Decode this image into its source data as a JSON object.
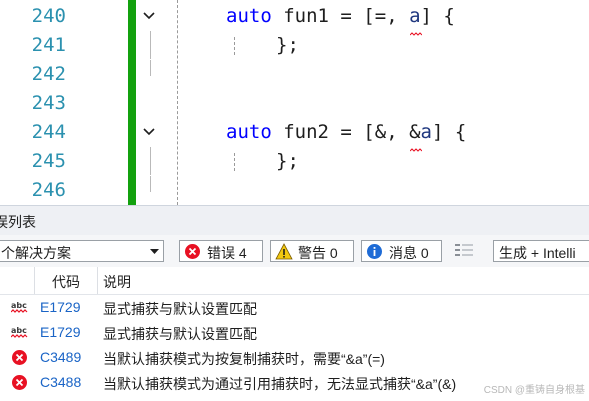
{
  "editor": {
    "lines": [
      {
        "number": "240",
        "code": {
          "kw": "auto",
          "name": "fun1",
          "capture": "=",
          "var": "a"
        }
      },
      {
        "number": "241",
        "text": "};"
      },
      {
        "number": "242"
      },
      {
        "number": "243"
      },
      {
        "number": "244",
        "code": {
          "kw": "auto",
          "name": "fun2",
          "capture": "&",
          "var": "a"
        }
      },
      {
        "number": "245",
        "text": "};"
      },
      {
        "number": "246"
      }
    ]
  },
  "error_list": {
    "title": "误列表",
    "scope": "个解决方案",
    "filters": {
      "errors": "错误 4",
      "warnings": "警告 0",
      "messages": "消息 0"
    },
    "build_source": "生成 + Intelli",
    "columns": {
      "code": "代码",
      "description": "说明"
    },
    "rows": [
      {
        "type": "intellisense",
        "code": "E1729",
        "description": "显式捕获与默认设置匹配"
      },
      {
        "type": "intellisense",
        "code": "E1729",
        "description": "显式捕获与默认设置匹配"
      },
      {
        "type": "error",
        "code": "C3489",
        "description": "当默认捕获模式为按复制捕获时，需要“&a”(=)"
      },
      {
        "type": "error",
        "code": "C3488",
        "description": "当默认捕获模式为通过引用捕获时，无法显式捕获“&a”(&)"
      }
    ]
  },
  "watermark": "CSDN @重铸自身根基",
  "colors": {
    "error": "#e81123",
    "warning": "#f2c811",
    "info": "#1e6bd6",
    "gutter": "#13a10e",
    "keyword": "#0000ff"
  }
}
